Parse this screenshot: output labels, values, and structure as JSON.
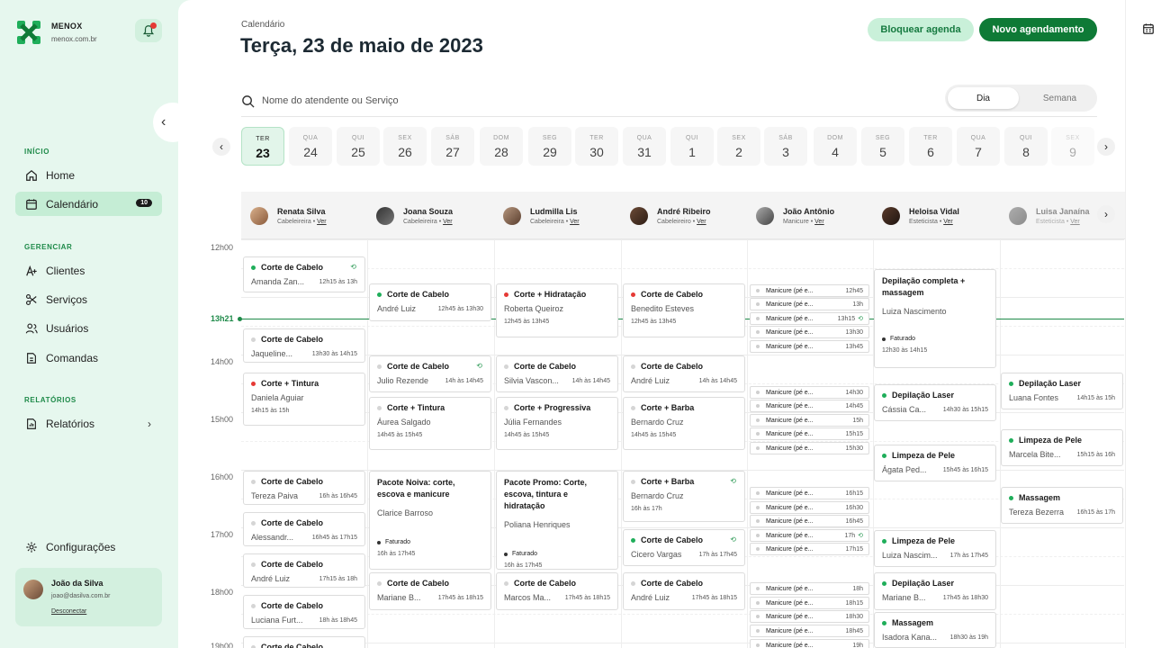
{
  "brand": {
    "name": "MENOX",
    "domain": "menox.com.br"
  },
  "sidebar": {
    "sections": {
      "inicio": "INÍCIO",
      "gerenciar": "GERENCIAR",
      "relatorios": "RELATÓRIOS"
    },
    "items": [
      {
        "label": "Home",
        "icon": "home-icon"
      },
      {
        "label": "Calendário",
        "icon": "calendar-icon",
        "count": "10"
      },
      {
        "label": "Clientes",
        "icon": "user-plus-icon"
      },
      {
        "label": "Serviços",
        "icon": "scissors-icon"
      },
      {
        "label": "Usuários",
        "icon": "users-icon"
      },
      {
        "label": "Comandas",
        "icon": "document-icon"
      },
      {
        "label": "Relatórios",
        "icon": "report-icon"
      }
    ],
    "settings": "Configurações",
    "user": {
      "name": "João da Silva",
      "email": "joao@dasilva.com.br",
      "logout": "Desconectar"
    }
  },
  "header": {
    "crumb": "Calendário",
    "title": "Terça, 23 de maio de 2023",
    "block_btn": "Bloquear agenda",
    "new_btn": "Novo agendamento",
    "search_placeholder": "Nome do atendente ou Serviço",
    "view_day": "Dia",
    "view_week": "Semana"
  },
  "days": [
    {
      "w": "TER",
      "n": "23"
    },
    {
      "w": "QUA",
      "n": "24"
    },
    {
      "w": "QUI",
      "n": "25"
    },
    {
      "w": "SEX",
      "n": "26"
    },
    {
      "w": "SÁB",
      "n": "27"
    },
    {
      "w": "DOM",
      "n": "28"
    },
    {
      "w": "SEG",
      "n": "29"
    },
    {
      "w": "TER",
      "n": "30"
    },
    {
      "w": "QUA",
      "n": "31"
    },
    {
      "w": "QUI",
      "n": "1"
    },
    {
      "w": "SEX",
      "n": "2"
    },
    {
      "w": "SÁB",
      "n": "3"
    },
    {
      "w": "DOM",
      "n": "4"
    },
    {
      "w": "SEG",
      "n": "5"
    },
    {
      "w": "TER",
      "n": "6"
    },
    {
      "w": "QUA",
      "n": "7"
    },
    {
      "w": "QUI",
      "n": "8"
    },
    {
      "w": "SEX",
      "n": "9"
    }
  ],
  "staff": [
    {
      "name": "Renata Silva",
      "role": "Cabeleireira",
      "link": "Ver"
    },
    {
      "name": "Joana Souza",
      "role": "Cabeleireira",
      "link": "Ver"
    },
    {
      "name": "Ludmilla Lis",
      "role": "Cabeleireira",
      "link": "Ver"
    },
    {
      "name": "André Ribeiro",
      "role": "Cabeleireiro",
      "link": "Ver"
    },
    {
      "name": "João Antônio",
      "role": "Manicure",
      "link": "Ver"
    },
    {
      "name": "Heloisa Vidal",
      "role": "Esteticista",
      "link": "Ver"
    },
    {
      "name": "Luisa Janaína",
      "role": "Esteticista",
      "link": "Ver"
    }
  ],
  "hours": [
    "12h00",
    "14h00",
    "15h00",
    "16h00",
    "17h00",
    "18h00",
    "19h00"
  ],
  "now": "13h21",
  "appointments": [
    {
      "title": "Corte de Cabelo",
      "client": "Amanda Zan...",
      "time": "12h15 às 13h",
      "dot": "g",
      "rep": true
    },
    {
      "title": "Corte de Cabelo",
      "client": "Jaqueline...",
      "time": "13h30 às 14h15",
      "dot": "n"
    },
    {
      "title": "Corte + Tintura",
      "client": "Daniela Aguiar",
      "time": "14h15 às 15h",
      "dot": "r",
      "stack": true
    },
    {
      "title": "Corte de Cabelo",
      "client": "Tereza Paiva",
      "time": "16h às 16h45",
      "dot": "n"
    },
    {
      "title": "Corte de Cabelo",
      "client": "Alessandr...",
      "time": "16h45 às 17h15",
      "dot": "n"
    },
    {
      "title": "Corte de Cabelo",
      "client": "André Luiz",
      "time": "17h15 às 18h",
      "dot": "n"
    },
    {
      "title": "Corte de Cabelo",
      "client": "Luciana Furt...",
      "time": "18h às 18h45",
      "dot": "n"
    },
    {
      "title": "Corte de Cabelo",
      "client": "",
      "time": "",
      "dot": "n"
    },
    {
      "title": "Corte de Cabelo",
      "client": "André Luiz",
      "time": "12h45 às 13h30",
      "dot": "g"
    },
    {
      "title": "Corte de Cabelo",
      "client": "Julio Rezende",
      "time": "14h às 14h45",
      "dot": "n",
      "rep": true
    },
    {
      "title": "Corte + Tintura",
      "client": "Áurea Salgado",
      "time": "14h45 às 15h45",
      "dot": "n",
      "stack": true
    },
    {
      "title": "Pacote Noiva: corte, escova e manicure",
      "client": "Clarice Barroso",
      "time": "16h às 17h45",
      "dot": "",
      "fat": "Faturado",
      "wrap": true
    },
    {
      "title": "Corte de Cabelo",
      "client": "Mariane B...",
      "time": "17h45 às 18h15",
      "dot": "n"
    },
    {
      "title": "Corte + Hidratação",
      "client": "Roberta Queiroz",
      "time": "12h45 às 13h45",
      "dot": "r",
      "stack": true
    },
    {
      "title": "Corte de Cabelo",
      "client": "Silvia Vascon...",
      "time": "14h às 14h45",
      "dot": "n"
    },
    {
      "title": "Corte + Progressiva",
      "client": "Júlia Fernandes",
      "time": "14h45 às 15h45",
      "dot": "n",
      "stack": true
    },
    {
      "title": "Pacote Promo: Corte, escova, tintura e hidratação",
      "client": "Poliana Henriques",
      "time": "16h às 17h45",
      "dot": "",
      "fat": "Faturado",
      "wrap": true
    },
    {
      "title": "Corte de Cabelo",
      "client": "Marcos Ma...",
      "time": "17h45 às 18h15",
      "dot": "n"
    },
    {
      "title": "Corte de Cabelo",
      "client": "Benedito Esteves",
      "time": "12h45 às 13h45",
      "dot": "r",
      "stack": true
    },
    {
      "title": "Corte de Cabelo",
      "client": "André Luiz",
      "time": "14h às 14h45",
      "dot": "n"
    },
    {
      "title": "Corte + Barba",
      "client": "Bernardo Cruz",
      "time": "14h45 às 15h45",
      "dot": "n",
      "stack": true
    },
    {
      "title": "Corte + Barba",
      "client": "Bernardo Cruz",
      "time": "16h às 17h",
      "dot": "n",
      "rep": true,
      "stack": true
    },
    {
      "title": "Corte de Cabelo",
      "client": "Cicero Vargas",
      "time": "17h às 17h45",
      "dot": "g",
      "rep": true
    },
    {
      "title": "Corte de Cabelo",
      "client": "André Luiz",
      "time": "17h45 às 18h15",
      "dot": "n"
    },
    {
      "title": "Depilação completa + massagem",
      "client": "Luiza Nascimento",
      "time": "12h30 às 14h15",
      "dot": "",
      "fat": "Faturado",
      "wrap": true
    },
    {
      "title": "Depilação Laser",
      "client": "Cássia Ca...",
      "time": "14h30 às 15h15",
      "dot": "g"
    },
    {
      "title": "Limpeza de Pele",
      "client": "Ágata Ped...",
      "time": "15h45 às 16h15",
      "dot": "g"
    },
    {
      "title": "Limpeza de Pele",
      "client": "Luiza Nascim...",
      "time": "17h às 17h45",
      "dot": "g"
    },
    {
      "title": "Depilação Laser",
      "client": "Mariane B...",
      "time": "17h45 às 18h30",
      "dot": "g"
    },
    {
      "title": "Massagem",
      "client": "Isadora Kana...",
      "time": "18h30 às 19h",
      "dot": "g"
    },
    {
      "title": "Depilação Laser",
      "client": "Luana Fontes",
      "time": "14h15 às 15h",
      "dot": "g"
    },
    {
      "title": "Limpeza de Pele",
      "client": "Marcela Bite...",
      "time": "15h15 às 16h",
      "dot": "g"
    },
    {
      "title": "Massagem",
      "client": "Tereza Bezerra",
      "time": "16h15 às 17h",
      "dot": "g"
    }
  ],
  "manicure": [
    {
      "label": "Manicure (pé e...",
      "time": "12h45"
    },
    {
      "label": "Manicure (pé e...",
      "time": "13h"
    },
    {
      "label": "Manicure (pé e...",
      "time": "13h15",
      "rep": true
    },
    {
      "label": "Manicure (pé e...",
      "time": "13h30"
    },
    {
      "label": "Manicure (pé e...",
      "time": "13h45"
    },
    {
      "label": "Manicure (pé e...",
      "time": "14h30"
    },
    {
      "label": "Manicure (pé e...",
      "time": "14h45"
    },
    {
      "label": "Manicure (pé e...",
      "time": "15h"
    },
    {
      "label": "Manicure (pé e...",
      "time": "15h15"
    },
    {
      "label": "Manicure (pé e...",
      "time": "15h30"
    },
    {
      "label": "Manicure (pé e...",
      "time": "16h15"
    },
    {
      "label": "Manicure (pé e...",
      "time": "16h30"
    },
    {
      "label": "Manicure (pé e...",
      "time": "16h45"
    },
    {
      "label": "Manicure (pé e...",
      "time": "17h",
      "rep": true
    },
    {
      "label": "Manicure (pé e...",
      "time": "17h15"
    },
    {
      "label": "Manicure (pé e...",
      "time": "18h"
    },
    {
      "label": "Manicure (pé e...",
      "time": "18h15"
    },
    {
      "label": "Manicure (pé e...",
      "time": "18h30"
    },
    {
      "label": "Manicure (pé e...",
      "time": "18h45"
    },
    {
      "label": "Manicure (pé e...",
      "time": "19h"
    }
  ]
}
